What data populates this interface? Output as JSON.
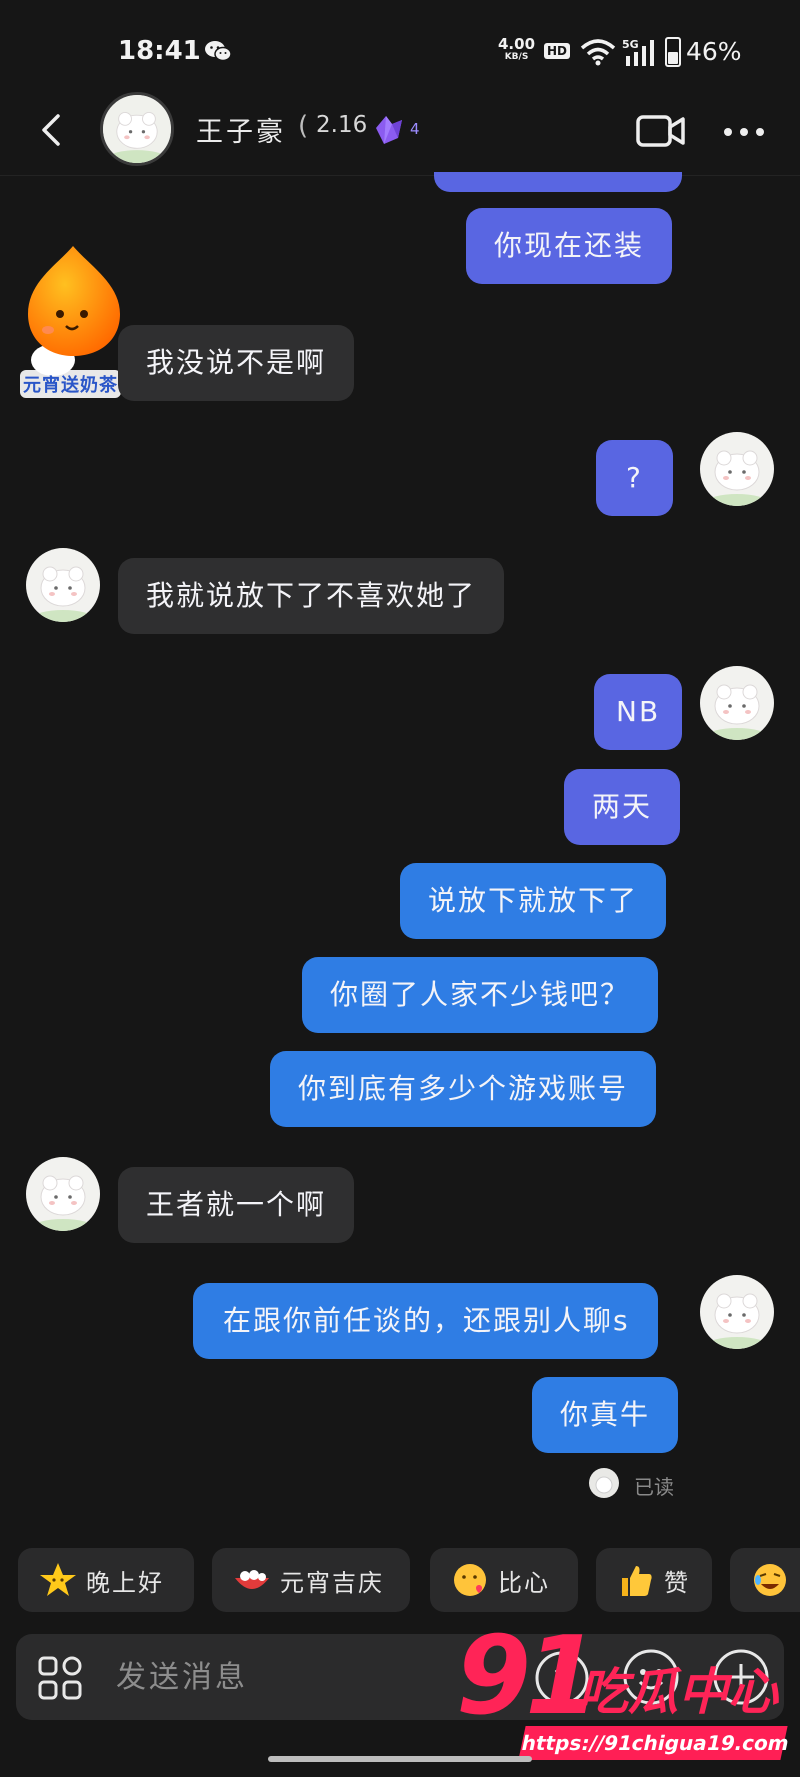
{
  "status_bar": {
    "time": "18:41",
    "net_speed": "4.00",
    "net_unit": "KB/S",
    "hd": "HD",
    "network_type": "5G",
    "battery": "46%"
  },
  "header": {
    "contact_name": "王子豪",
    "paren": "(",
    "score": "2.16",
    "level": "4",
    "icons": [
      "back-icon",
      "crystal-icon",
      "video-call-icon",
      "more-icon"
    ]
  },
  "messages": [
    {
      "side": "out",
      "text": "你现在还装"
    },
    {
      "side": "in",
      "text": "我没说不是啊"
    },
    {
      "side": "out",
      "text": "?"
    },
    {
      "side": "in",
      "text": "我就说放下了不喜欢她了"
    },
    {
      "side": "out",
      "text": "NB"
    },
    {
      "side": "out",
      "text": "两天"
    },
    {
      "side": "out",
      "text": "说放下就放下了"
    },
    {
      "side": "out",
      "text": "你圈了人家不少钱吧？"
    },
    {
      "side": "out",
      "text": "你到底有多少个游戏账号"
    },
    {
      "side": "in",
      "text": "王者就一个啊"
    },
    {
      "side": "out",
      "text": "在跟你前任谈的，还跟别人聊s"
    },
    {
      "side": "out",
      "text": "你真牛"
    }
  ],
  "sticker_label": "元宵送奶茶",
  "read_status": "已读",
  "quick_replies": [
    {
      "label": "晚上好",
      "icon": "star-emoji-icon"
    },
    {
      "label": "元宵吉庆",
      "icon": "yuanxiao-bowl-icon"
    },
    {
      "label": "比心",
      "icon": "heart-hands-emoji-icon"
    },
    {
      "label": "赞",
      "icon": "thumbs-up-icon"
    },
    {
      "label": "",
      "icon": "laughing-emoji-icon"
    }
  ],
  "input": {
    "placeholder": "发送消息"
  },
  "watermark": {
    "brand_number": "91",
    "brand_text": "吃瓜中心",
    "url": "https://91chigua19.com"
  }
}
